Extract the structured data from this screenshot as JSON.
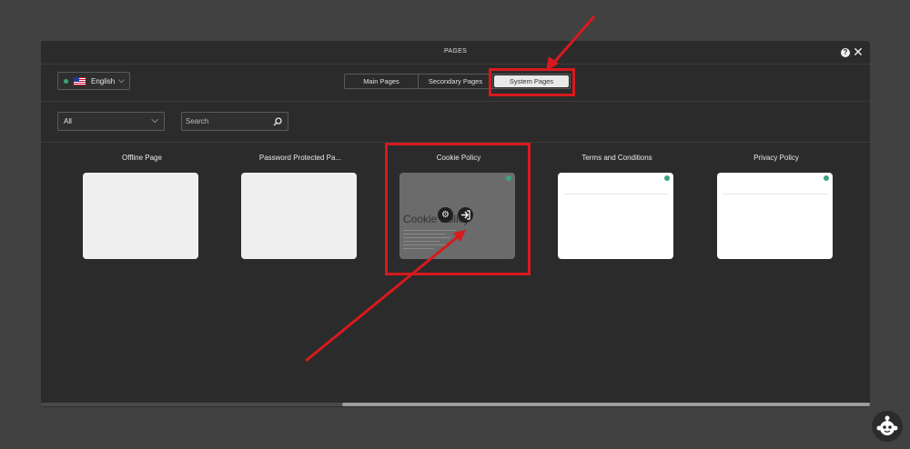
{
  "modal": {
    "title": "PAGES",
    "help_label": "?",
    "close_label": "✕"
  },
  "language": {
    "label": "English",
    "status_color": "#3fa37a",
    "chevron": "⌵"
  },
  "tabs": [
    {
      "label": "Main Pages",
      "active": false
    },
    {
      "label": "Secondary Pages",
      "active": false
    },
    {
      "label": "System Pages",
      "active": true
    }
  ],
  "filter": {
    "selected": "All",
    "chevron": "⌵",
    "search_placeholder": "Search"
  },
  "cards": [
    {
      "title": "Offline Page",
      "published": false
    },
    {
      "title": "Password Protected Pa...",
      "published": false
    },
    {
      "title": "Cookie Policy",
      "published": true,
      "thumb_heading": "Cookie Policy",
      "actions": [
        "gear-icon",
        "enter-icon"
      ]
    },
    {
      "title": "Terms and Conditions",
      "published": true
    },
    {
      "title": "Privacy Policy",
      "published": true
    }
  ],
  "accent_colors": {
    "highlight": "#d8191e",
    "published_dot": "#3fa37a"
  }
}
